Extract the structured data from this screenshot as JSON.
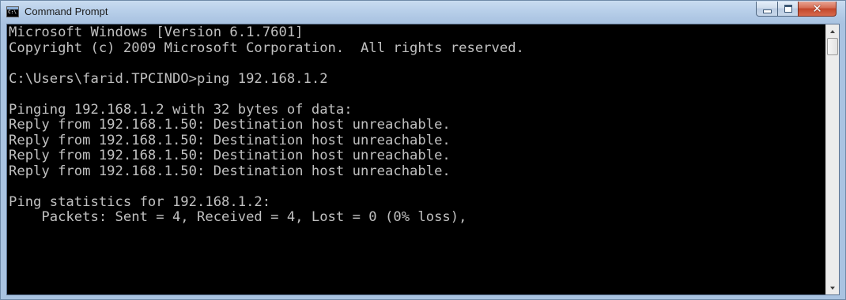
{
  "window": {
    "title": "Command Prompt",
    "app_icon_text": "C:\\"
  },
  "controls": {
    "close_glyph": "✕"
  },
  "console": {
    "lines": [
      "Microsoft Windows [Version 6.1.7601]",
      "Copyright (c) 2009 Microsoft Corporation.  All rights reserved.",
      "",
      "C:\\Users\\farid.TPCINDO>ping 192.168.1.2",
      "",
      "Pinging 192.168.1.2 with 32 bytes of data:",
      "Reply from 192.168.1.50: Destination host unreachable.",
      "Reply from 192.168.1.50: Destination host unreachable.",
      "Reply from 192.168.1.50: Destination host unreachable.",
      "Reply from 192.168.1.50: Destination host unreachable.",
      "",
      "Ping statistics for 192.168.1.2:",
      "    Packets: Sent = 4, Received = 4, Lost = 0 (0% loss),"
    ],
    "text_color": "#c0c0c0",
    "background_color": "#000000"
  },
  "colors": {
    "close_button": "#c2462b",
    "titlebar": "#b9d0ea"
  }
}
